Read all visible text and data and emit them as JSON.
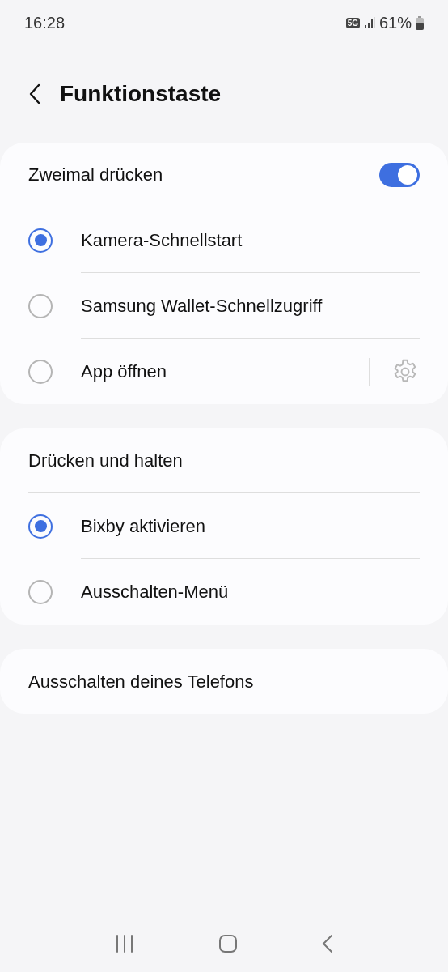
{
  "status_bar": {
    "time": "16:28",
    "network": "5G",
    "battery": "61%"
  },
  "header": {
    "title": "Funktionstaste"
  },
  "sections": [
    {
      "title": "Zweimal drücken",
      "toggle": {
        "on": true
      },
      "options": [
        {
          "label": "Kamera-Schnellstart",
          "selected": true,
          "kind": "radio"
        },
        {
          "label": "Samsung Wallet-Schnellzugriff",
          "selected": false,
          "kind": "radio"
        },
        {
          "label": "App öffnen",
          "selected": false,
          "kind": "radio-settings"
        }
      ]
    },
    {
      "title": "Drücken und halten",
      "options": [
        {
          "label": "Bixby aktivieren",
          "selected": true,
          "kind": "radio"
        },
        {
          "label": "Ausschalten-Menü",
          "selected": false,
          "kind": "radio"
        }
      ]
    },
    {
      "title": "Ausschalten deines Telefons"
    }
  ]
}
